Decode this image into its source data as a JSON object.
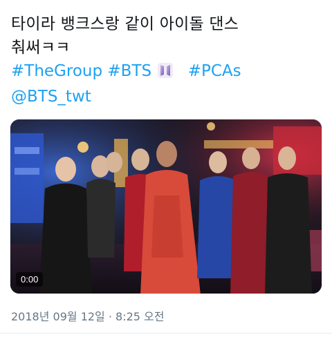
{
  "tweet": {
    "text_line1": "타이라 뱅크스랑 같이 아이돌 댄스",
    "text_line2": "춰써ㅋㅋ",
    "hashtags_line": {
      "tag1": "#TheGroup",
      "tag2": "#BTS",
      "tag3": "#PCAs"
    },
    "mention": "@BTS_twt",
    "link_color": "#1da1f2",
    "media": {
      "duration": "0:00"
    },
    "timestamp": "2018년 09월 12일 · 8:25 오전"
  }
}
